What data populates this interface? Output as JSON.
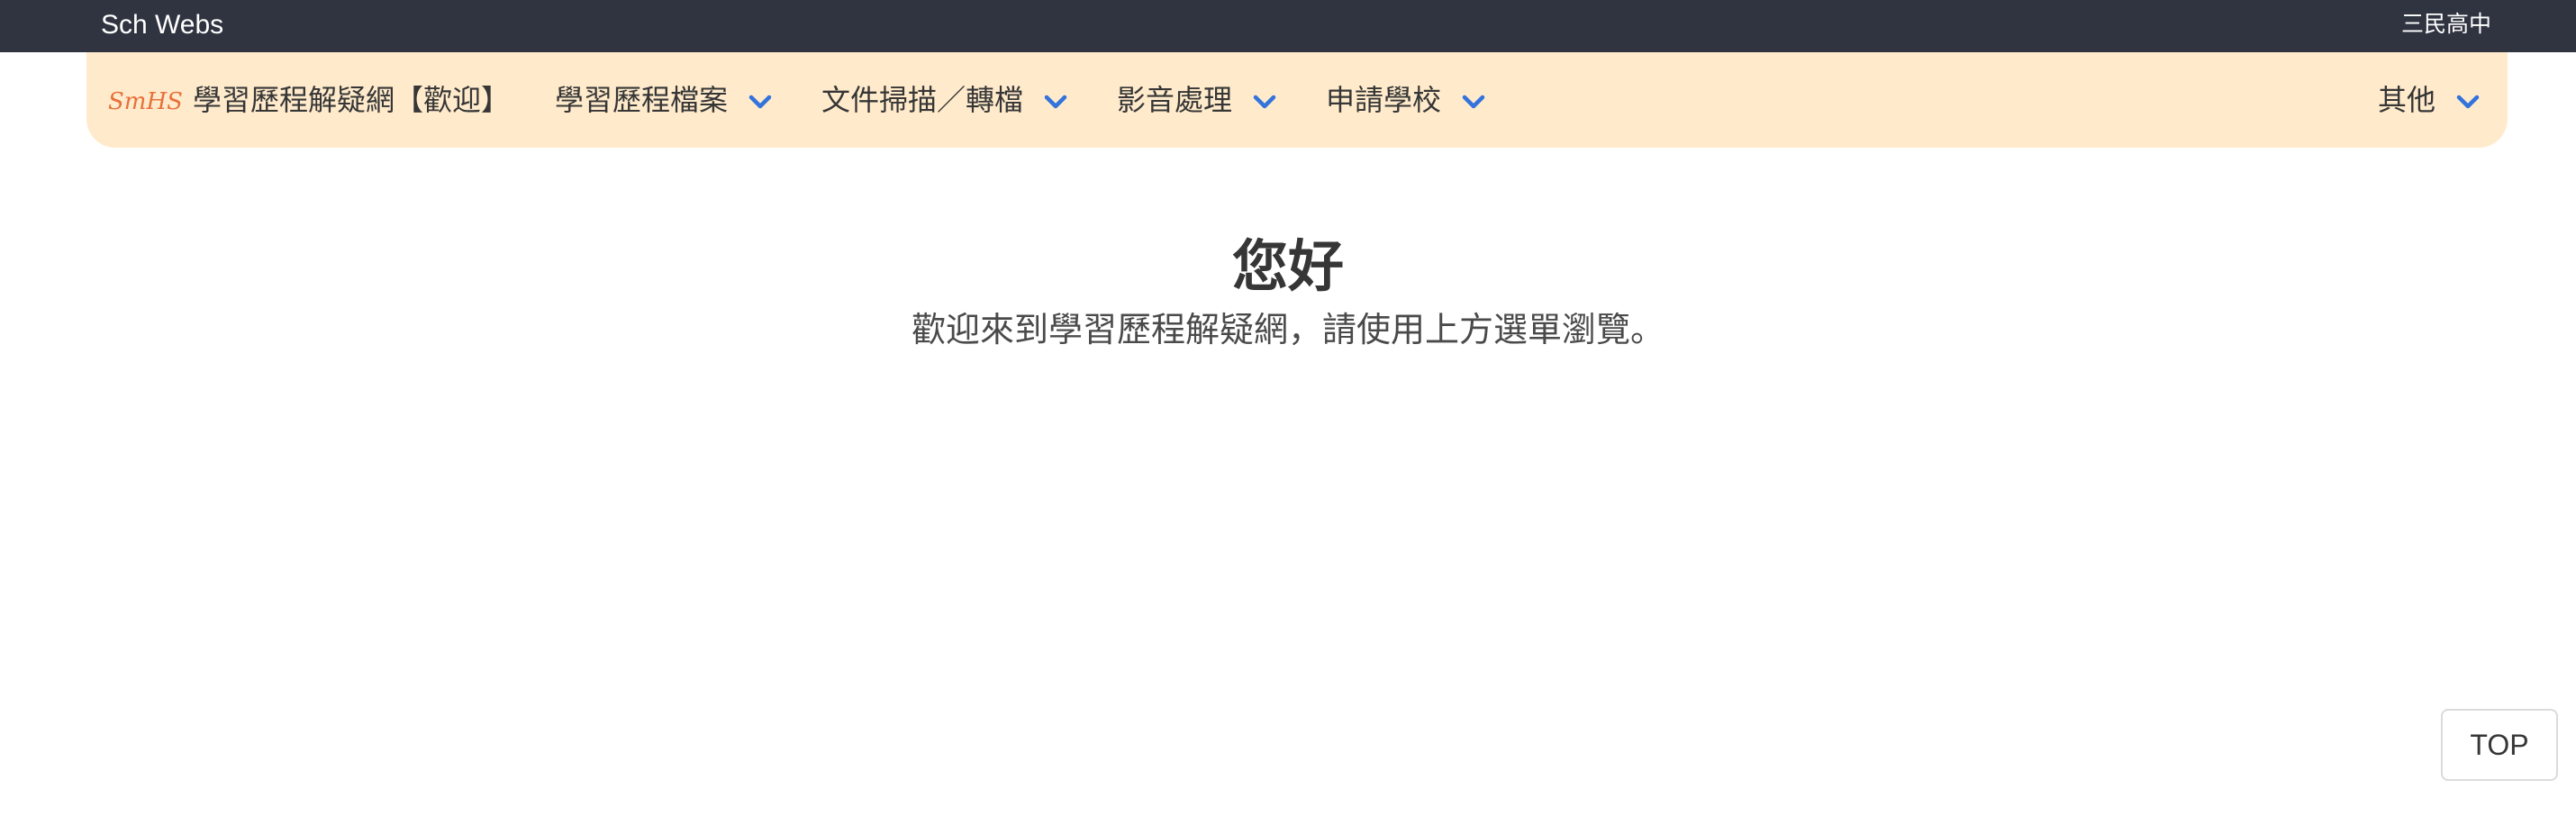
{
  "topbar": {
    "title": "Sch Webs",
    "school": "三民高中"
  },
  "navbar": {
    "logo_text": "SmHS",
    "brand_label": "學習歷程解疑網【歡迎】",
    "menus": [
      {
        "label": "學習歷程檔案",
        "icon": "chevron-down-icon"
      },
      {
        "label": "文件掃描／轉檔",
        "icon": "chevron-down-icon"
      },
      {
        "label": "影音處理",
        "icon": "chevron-down-icon"
      },
      {
        "label": "申請學校",
        "icon": "chevron-down-icon"
      }
    ],
    "other_menu": {
      "label": "其他",
      "icon": "chevron-down-icon"
    }
  },
  "hero": {
    "title": "您好",
    "subtitle": "歡迎來到學習歷程解疑網，請使用上方選單瀏覽。"
  },
  "back_to_top": {
    "label": "TOP"
  },
  "colors": {
    "topbar_bg": "#2f3440",
    "navbar_bg": "#ffebcc",
    "chevron": "#3273dc",
    "logo": "#e8703a",
    "text": "#363636"
  }
}
